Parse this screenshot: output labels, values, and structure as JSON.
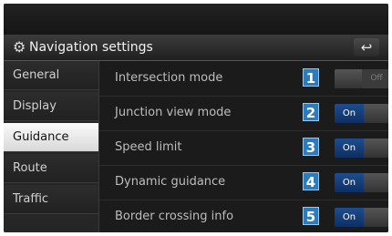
{
  "header": {
    "title": "Navigation settings",
    "settings_icon": "gear-icon",
    "back_icon": "back-arrow-icon"
  },
  "sidebar": {
    "items": [
      {
        "label": "General",
        "active": false
      },
      {
        "label": "Display",
        "active": false
      },
      {
        "label": "Guidance",
        "active": true
      },
      {
        "label": "Route",
        "active": false
      },
      {
        "label": "Traffic",
        "active": false
      }
    ]
  },
  "settings": [
    {
      "number": "1",
      "label": "Intersection mode",
      "state": "Off"
    },
    {
      "number": "2",
      "label": "Junction view mode",
      "state": "On"
    },
    {
      "number": "3",
      "label": "Speed limit",
      "state": "On"
    },
    {
      "number": "4",
      "label": "Dynamic guidance",
      "state": "On"
    },
    {
      "number": "5",
      "label": "Border crossing info",
      "state": "On"
    }
  ],
  "colors": {
    "accent_blue": "#2b7bbf",
    "toggle_on": "#1d4d8f",
    "background": "#1b1b1b"
  }
}
